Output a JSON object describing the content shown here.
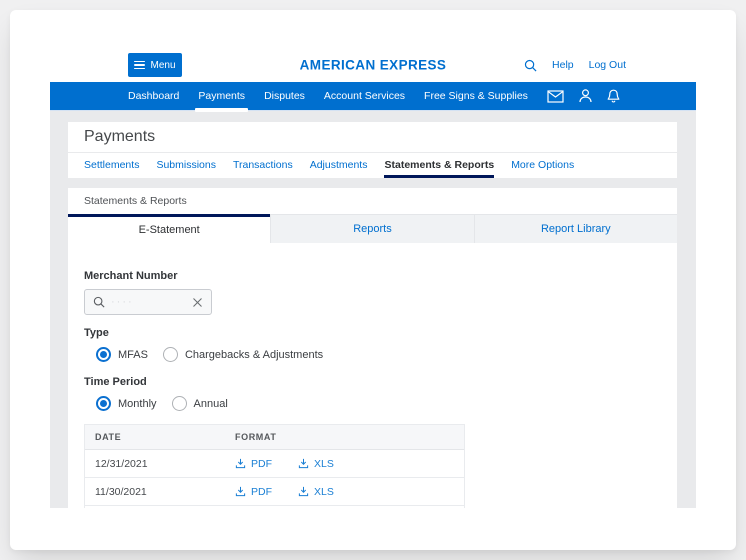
{
  "header": {
    "menu_label": "Menu",
    "logo": "AMERICAN EXPRESS",
    "help": "Help",
    "logout": "Log Out"
  },
  "nav": {
    "items": [
      {
        "label": "Dashboard",
        "active": false
      },
      {
        "label": "Payments",
        "active": true
      },
      {
        "label": "Disputes",
        "active": false
      },
      {
        "label": "Account Services",
        "active": false
      },
      {
        "label": "Free Signs & Supplies",
        "active": false
      }
    ]
  },
  "page": {
    "title": "Payments"
  },
  "subtabs": {
    "items": [
      "Settlements",
      "Submissions",
      "Transactions",
      "Adjustments",
      "Statements & Reports",
      "More Options"
    ],
    "active": "Statements & Reports"
  },
  "section": {
    "label": "Statements & Reports"
  },
  "tabs": {
    "items": [
      "E-Statement",
      "Reports",
      "Report Library"
    ],
    "active": "E-Statement"
  },
  "filters": {
    "merchant_number": {
      "label": "Merchant Number",
      "value": "",
      "placeholder": "····"
    },
    "type": {
      "label": "Type",
      "options": [
        {
          "label": "MFAS",
          "selected": true
        },
        {
          "label": "Chargebacks & Adjustments",
          "selected": false
        }
      ]
    },
    "time_period": {
      "label": "Time Period",
      "options": [
        {
          "label": "Monthly",
          "selected": true
        },
        {
          "label": "Annual",
          "selected": false
        }
      ]
    }
  },
  "table": {
    "columns": [
      "DATE",
      "FORMAT"
    ],
    "rows": [
      {
        "date": "12/31/2021",
        "formats": [
          "PDF",
          "XLS"
        ]
      },
      {
        "date": "11/30/2021",
        "formats": [
          "PDF",
          "XLS"
        ]
      }
    ]
  },
  "colors": {
    "brand": "#006fcf",
    "navy": "#00175a",
    "app_background": "#e9eaec"
  }
}
